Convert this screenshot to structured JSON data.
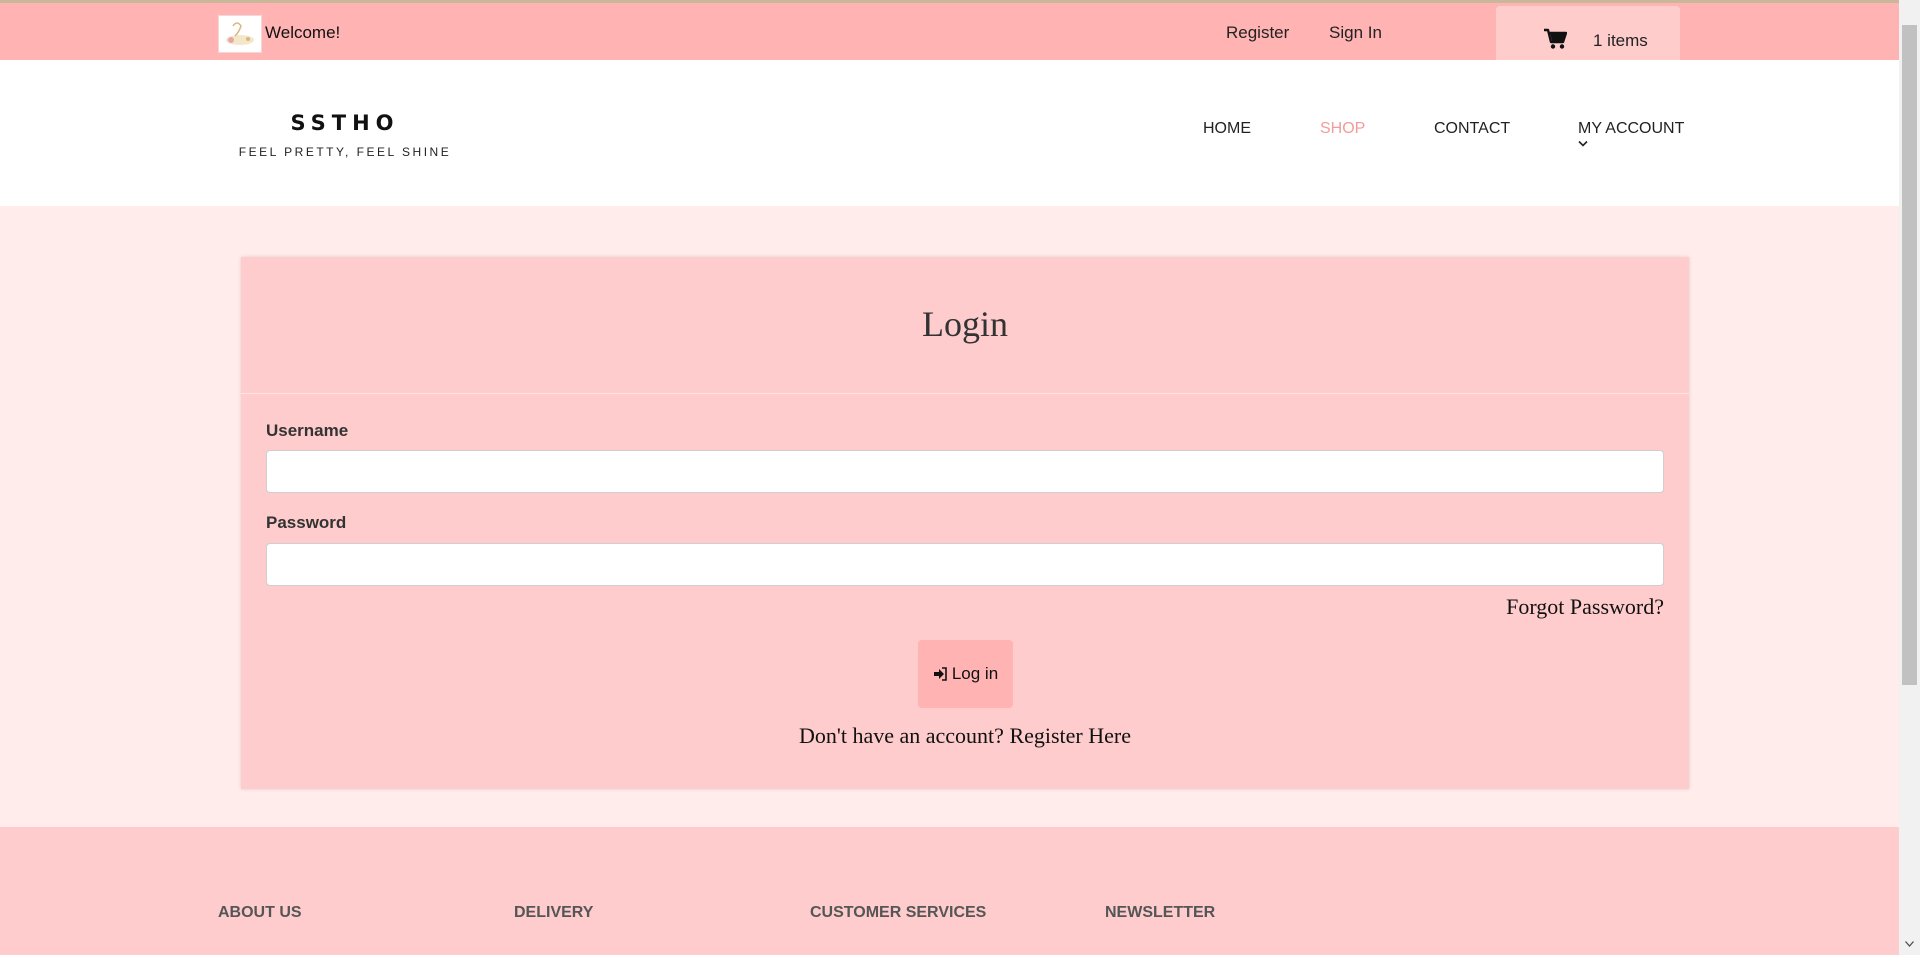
{
  "topbar": {
    "welcome": "Welcome!",
    "register": "Register",
    "sign_in": "Sign In",
    "cart_count": "1 items"
  },
  "brand": {
    "name": "SSTHO",
    "tagline": "FEEL PRETTY, FEEL SHINE"
  },
  "nav": {
    "home": "HOME",
    "shop": "SHOP",
    "contact": "CONTACT",
    "my_account": "MY ACCOUNT"
  },
  "login": {
    "title": "Login",
    "username_label": "Username",
    "username_value": "",
    "password_label": "Password",
    "password_value": "",
    "forgot": "Forgot Password?",
    "button": "Log in",
    "no_account": "Don't have an account?",
    "register_here": "Register Here"
  },
  "footer": {
    "about": "ABOUT US",
    "delivery": "DELIVERY",
    "customer_services": "CUSTOMER SERVICES",
    "newsletter": "NEWSLETTER"
  },
  "colors": {
    "topbar_bg": "#ffb3b3",
    "main_bg": "#ffeceb",
    "card_bg": "#fecccc",
    "accent": "#f29b9b"
  },
  "icons": {
    "cart": "cart-icon",
    "login": "sign-in-icon",
    "dropdown": "chevron-down-icon"
  }
}
